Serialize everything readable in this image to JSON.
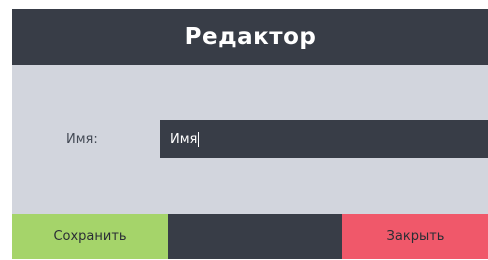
{
  "window": {
    "title": "Редактор"
  },
  "form": {
    "name_label": "Имя:",
    "name_value": "Имя"
  },
  "buttons": {
    "save_label": "Сохранить",
    "close_label": "Закрыть"
  },
  "colors": {
    "dark": "#383d47",
    "content_bg": "#d2d5dd",
    "save": "#a5d46a",
    "close": "#f0586a"
  }
}
